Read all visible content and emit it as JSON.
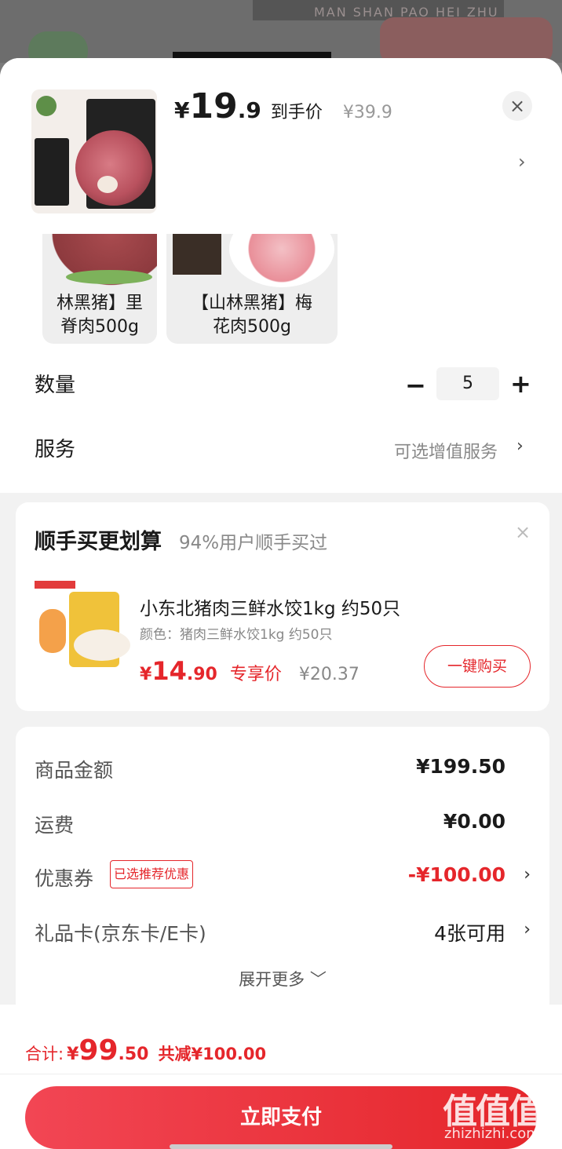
{
  "background": {
    "banner_text": "MAN SHAN PAO HEI ZHU"
  },
  "header": {
    "price_symbol": "¥",
    "price_integer": "19",
    "price_decimal": ".9",
    "price_tag": "到手价",
    "original_price": "¥39.9",
    "close_icon": "close-icon",
    "chevron_icon": "chevron-right-icon"
  },
  "product_options": [
    {
      "label": "林黑猪】里\n脊肉500g",
      "line1": "林黑猪】里",
      "line2": "脊肉500g"
    },
    {
      "label": "【山林黑猪】梅\n花肉500g",
      "line1": "【山林黑猪】梅",
      "line2": "花肉500g"
    }
  ],
  "quantity": {
    "label": "数量",
    "minus": "−",
    "value": "5",
    "plus": "+"
  },
  "service": {
    "label": "服务",
    "value": "可选增值服务",
    "chevron": "›"
  },
  "addon": {
    "title": "顺手买更划算",
    "subtitle": "94%用户顺手买过",
    "close": "×",
    "item": {
      "name": "小东北猪肉三鲜水饺1kg 约50只",
      "spec": "颜色：猪肉三鲜水饺1kg 约50只",
      "price_symbol": "¥",
      "price_integer": "14",
      "price_decimal": ".90",
      "price_tag": "专享价",
      "original_price": "¥20.37",
      "buy_label": "一键购买"
    }
  },
  "summary": {
    "rows": [
      {
        "label": "商品金额",
        "value": "¥199.50"
      },
      {
        "label": "运费",
        "value": "¥0.00"
      },
      {
        "label": "优惠券",
        "tag": "已选推荐优惠",
        "value": "-¥100.00",
        "chevron": "›"
      },
      {
        "label": "礼品卡(京东卡/E卡)",
        "value": "4张可用",
        "chevron": "›"
      }
    ],
    "expand_label": "展开更多 ﹀"
  },
  "footer": {
    "total_label": "合计:",
    "total_symbol": "¥",
    "total_integer": "99",
    "total_decimal": ".50",
    "saved_label": "共减¥100.00",
    "pay_label": "立即支付"
  },
  "watermark": {
    "main": "值值值",
    "sub": "zhizhizhi.com"
  },
  "colors": {
    "accent": "#e5262b",
    "muted": "#888888"
  }
}
